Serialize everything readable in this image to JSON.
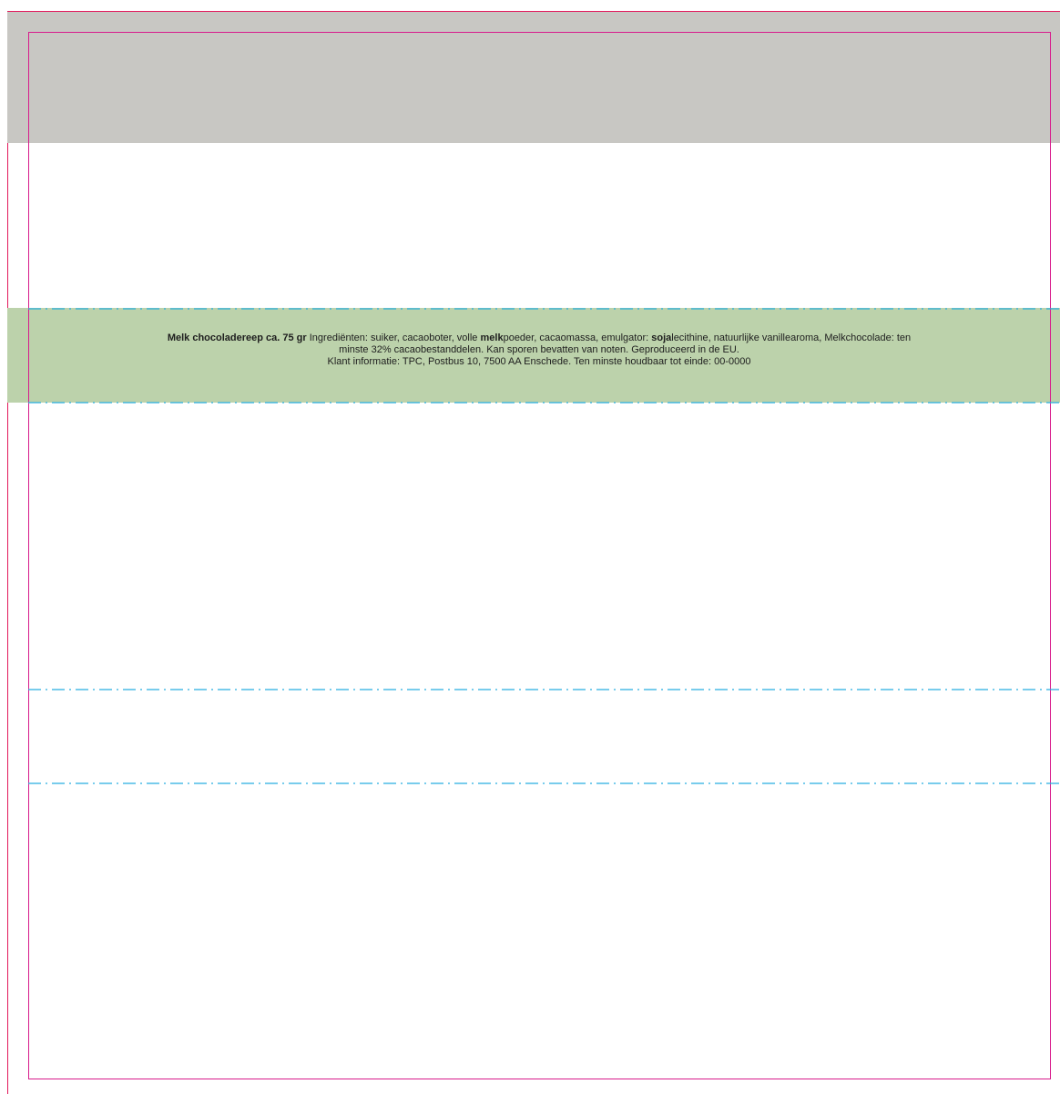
{
  "colors": {
    "top_band": "#c8c7c3",
    "label_band": "#bcd2ab",
    "frame_line": "#d81b8c",
    "fold_line": "#27aee0"
  },
  "label": {
    "product_name": "Melk chocoladereep ca. 75 gr",
    "ingredients_prefix": "Ingrediënten: suiker, cacaoboter, volle",
    "milk_allergen": "melk",
    "ingredients_mid": "poeder, cacaomassa, emulgator:",
    "soy_allergen": "soja",
    "ingredients_suffix": "lecithine, natuurlijke vanillearoma, Melkchocolade: ten",
    "line2": "minste 32% cacaobestanddelen. Kan sporen bevatten van noten. Geproduceerd in de EU.",
    "line3": "Klant informatie: TPC, Postbus 10, 7500 AA Enschede. Ten minste houdbaar tot einde: 00-0000"
  }
}
